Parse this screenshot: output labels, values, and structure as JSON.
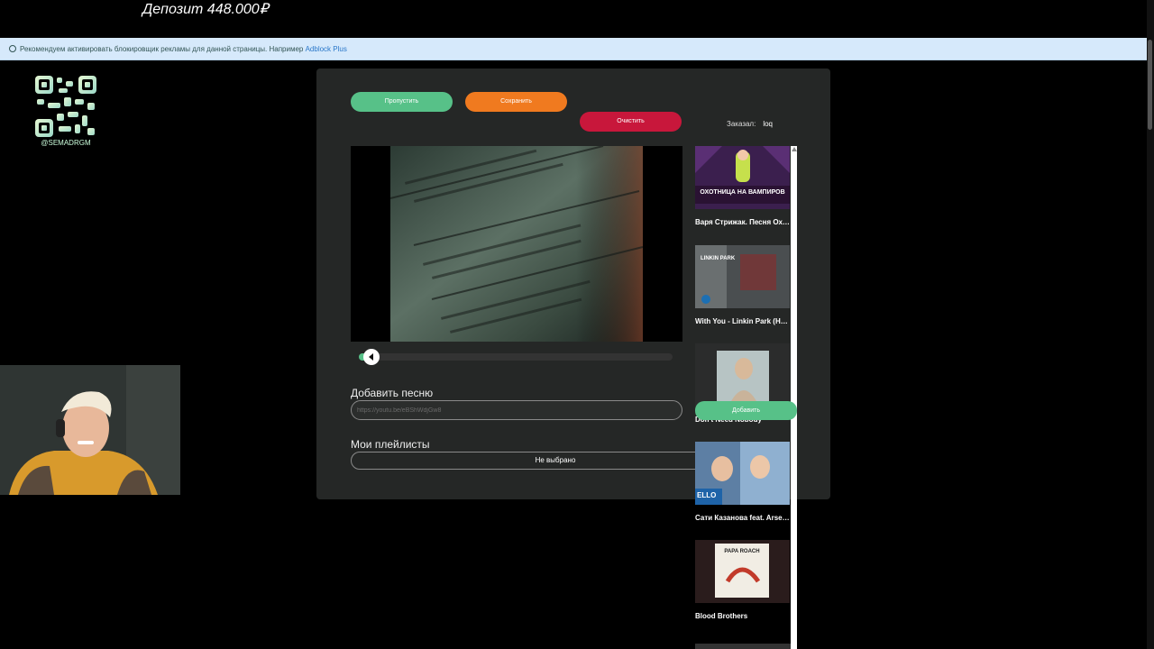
{
  "overlay": {
    "deposit": "Депозит 448.000₽",
    "handle": "@SEMADRGM"
  },
  "adblock": {
    "text": "Рекомендуем активировать блокировщик рекламы для данной страницы. Например ",
    "link": "Adblock Plus"
  },
  "controls": {
    "skip": "Пропустить",
    "save": "Сохранить",
    "clear": "Очистить"
  },
  "ordered": {
    "label": "Заказал:",
    "user": "loq"
  },
  "player": {
    "progress_fraction": 0.04
  },
  "add_song": {
    "label": "Добавить песню",
    "placeholder": "https://youtu.be/eBShWdjGw8"
  },
  "playlists": {
    "label": "Мои плейлисты",
    "selected": "Не выбрано"
  },
  "queue": {
    "add_button": "Добавить",
    "items": [
      {
        "title": "Варя Стрижак. Песня Охотницы на вампиров",
        "thumb_text": "ОХОТНИЦА НА ВАМПИРОВ"
      },
      {
        "title": "With You - Linkin Park (HD Video)",
        "thumb_text": "LINKIN PARK"
      },
      {
        "title": "Don't Need Nobody",
        "thumb_text": ""
      },
      {
        "title": "Сати Казанова feat. Arsenium",
        "thumb_text": "ELLO"
      },
      {
        "title": "Blood Brothers",
        "thumb_text": "PAPA ROACH"
      }
    ]
  }
}
